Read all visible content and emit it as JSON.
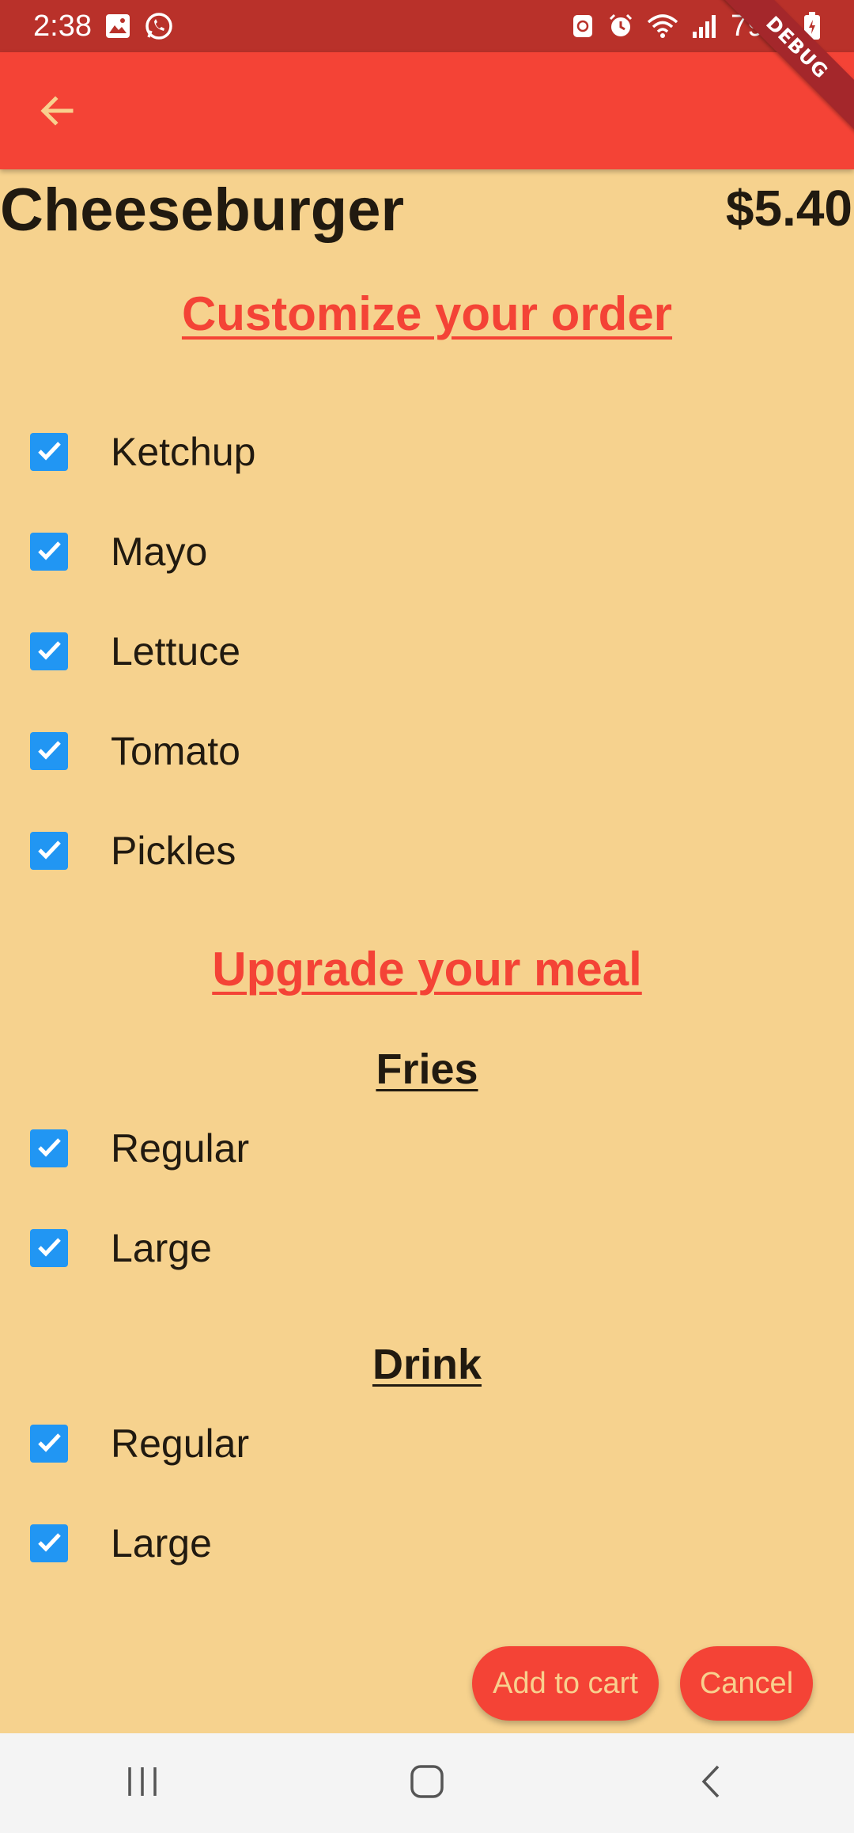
{
  "status_bar": {
    "time": "2:38",
    "battery": "79%"
  },
  "debug_banner": "DEBUG",
  "product": {
    "name": "Cheeseburger",
    "price": "$5.40"
  },
  "customize": {
    "title": "Customize your order",
    "options": [
      {
        "label": "Ketchup",
        "checked": true
      },
      {
        "label": "Mayo",
        "checked": true
      },
      {
        "label": "Lettuce",
        "checked": true
      },
      {
        "label": "Tomato",
        "checked": true
      },
      {
        "label": "Pickles",
        "checked": true
      }
    ]
  },
  "upgrade": {
    "title": "Upgrade your meal",
    "fries": {
      "title": "Fries",
      "options": [
        {
          "label": "Regular",
          "checked": true
        },
        {
          "label": "Large",
          "checked": true
        }
      ]
    },
    "drink": {
      "title": "Drink",
      "options": [
        {
          "label": "Regular",
          "checked": true
        },
        {
          "label": "Large",
          "checked": true
        }
      ]
    }
  },
  "actions": {
    "add_to_cart": "Add to cart",
    "cancel": "Cancel"
  },
  "colors": {
    "background": "#F6D28E",
    "app_bar": "#F44336",
    "status_bar": "#B9312A",
    "checkbox": "#2196F3",
    "accent_text": "#F44336"
  },
  "icons": {
    "back": "arrow-left-icon",
    "check": "check-icon",
    "nav_recents": "recents-icon",
    "nav_home": "home-icon",
    "nav_back": "nav-back-icon"
  }
}
